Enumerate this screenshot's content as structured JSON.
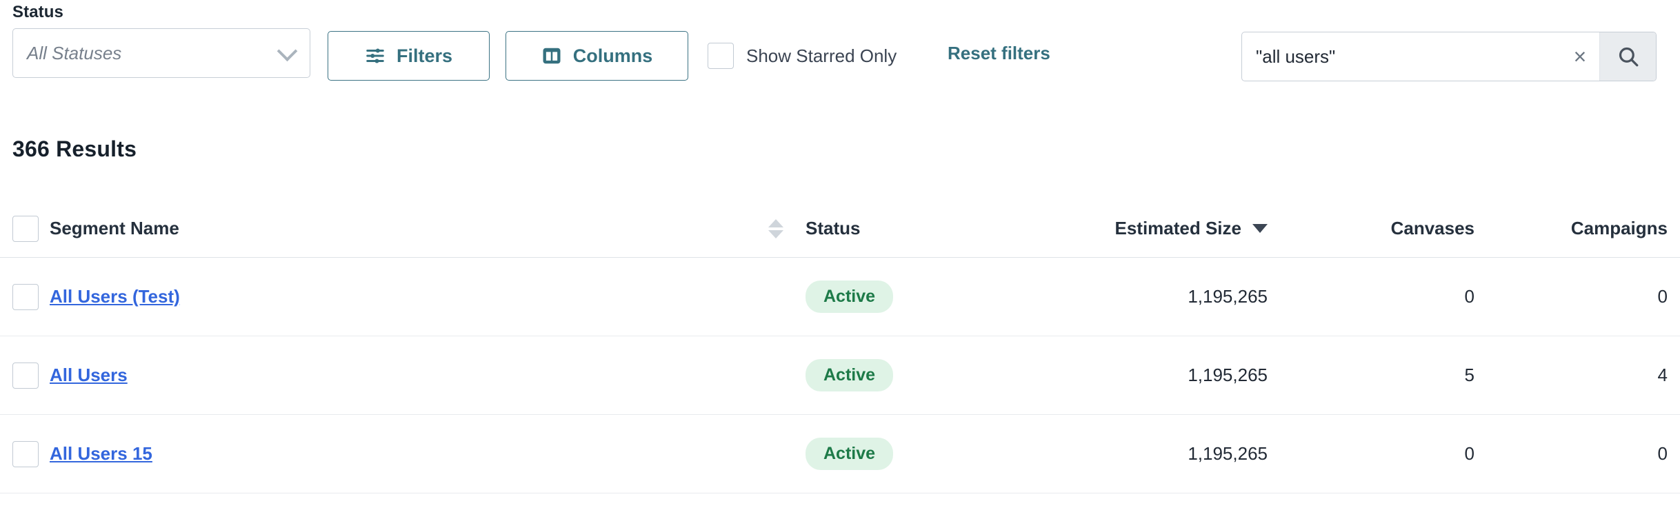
{
  "filters": {
    "status_label": "Status",
    "status_select_value": "",
    "status_select_placeholder": "All Statuses",
    "filters_button": "Filters",
    "columns_button": "Columns",
    "show_starred_label": "Show Starred Only",
    "show_starred_checked": false,
    "reset_filters": "Reset filters",
    "search_value": "\"all users\"",
    "search_placeholder": "Search",
    "icons": {
      "chevron": "chevron-down-icon",
      "filters": "sliders-icon",
      "columns": "columns-icon",
      "clear": "×",
      "search": "search-icon"
    }
  },
  "results": {
    "count_text": "366 Results"
  },
  "table": {
    "columns": {
      "segment_name": "Segment Name",
      "status": "Status",
      "estimated_size": "Estimated Size",
      "canvases": "Canvases",
      "campaigns": "Campaigns"
    },
    "sort": {
      "active_column": "Estimated Size",
      "direction": "desc"
    },
    "rows": [
      {
        "name": "All Users (Test)",
        "status": "Active",
        "estimated_size": "1,195,265",
        "canvases": "0",
        "campaigns": "0",
        "selected": false
      },
      {
        "name": "All Users",
        "status": "Active",
        "estimated_size": "1,195,265",
        "canvases": "5",
        "campaigns": "4",
        "selected": false
      },
      {
        "name": "All Users 15",
        "status": "Active",
        "estimated_size": "1,195,265",
        "canvases": "0",
        "campaigns": "0",
        "selected": false
      }
    ]
  },
  "colors": {
    "accent_teal": "#35707f",
    "link_blue": "#3366dd",
    "badge_bg": "#dff3e6",
    "badge_text": "#1d7a48",
    "text_dark": "#1f2733",
    "border": "#c7ced6"
  }
}
